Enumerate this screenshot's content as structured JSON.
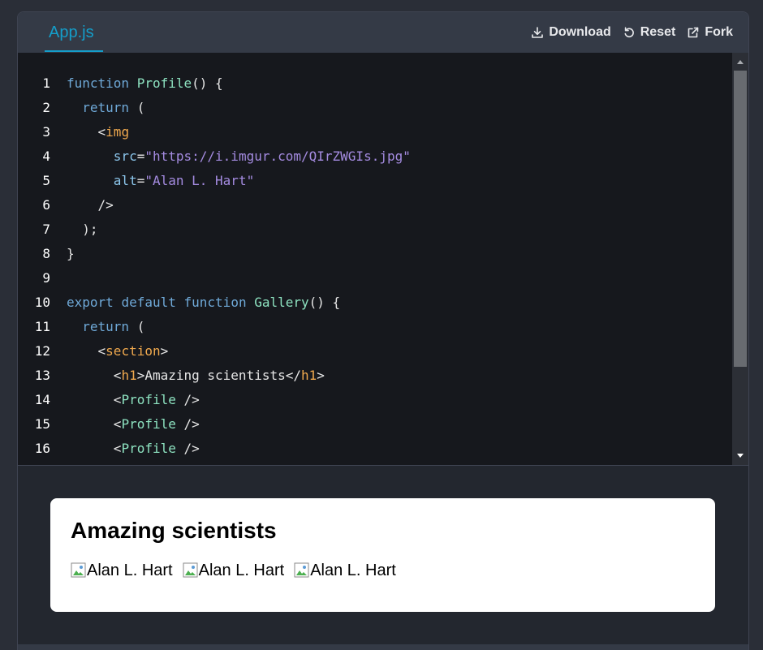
{
  "tab": {
    "label": "App.js"
  },
  "actions": [
    {
      "label": "Download",
      "icon": "download-icon"
    },
    {
      "label": "Reset",
      "icon": "reset-icon"
    },
    {
      "label": "Fork",
      "icon": "external-link-icon"
    }
  ],
  "colors": {
    "accent": "#149eca",
    "keyword": "#6fa9d8",
    "function_name": "#8de2c0",
    "tag": "#f0a94e",
    "attribute": "#8cc6ec",
    "string": "#a48be0"
  },
  "code": {
    "lines": [
      {
        "n": "1",
        "tokens": [
          [
            "kw",
            "function"
          ],
          [
            "p",
            " "
          ],
          [
            "fn",
            "Profile"
          ],
          [
            "p",
            "() {"
          ]
        ]
      },
      {
        "n": "2",
        "tokens": [
          [
            "p",
            "  "
          ],
          [
            "kw",
            "return"
          ],
          [
            "p",
            " ("
          ]
        ]
      },
      {
        "n": "3",
        "tokens": [
          [
            "p",
            "    <"
          ],
          [
            "tag",
            "img"
          ]
        ]
      },
      {
        "n": "4",
        "tokens": [
          [
            "p",
            "      "
          ],
          [
            "attr",
            "src"
          ],
          [
            "p",
            "="
          ],
          [
            "str",
            "\"https://i.imgur.com/QIrZWGIs.jpg\""
          ]
        ]
      },
      {
        "n": "5",
        "tokens": [
          [
            "p",
            "      "
          ],
          [
            "attr",
            "alt"
          ],
          [
            "p",
            "="
          ],
          [
            "str",
            "\"Alan L. Hart\""
          ]
        ]
      },
      {
        "n": "6",
        "tokens": [
          [
            "p",
            "    />"
          ]
        ]
      },
      {
        "n": "7",
        "tokens": [
          [
            "p",
            "  );"
          ]
        ]
      },
      {
        "n": "8",
        "tokens": [
          [
            "p",
            "}"
          ]
        ]
      },
      {
        "n": "9",
        "tokens": []
      },
      {
        "n": "10",
        "tokens": [
          [
            "kw",
            "export"
          ],
          [
            "p",
            " "
          ],
          [
            "kw",
            "default"
          ],
          [
            "p",
            " "
          ],
          [
            "kw",
            "function"
          ],
          [
            "p",
            " "
          ],
          [
            "fn",
            "Gallery"
          ],
          [
            "p",
            "() {"
          ]
        ]
      },
      {
        "n": "11",
        "tokens": [
          [
            "p",
            "  "
          ],
          [
            "kw",
            "return"
          ],
          [
            "p",
            " ("
          ]
        ]
      },
      {
        "n": "12",
        "tokens": [
          [
            "p",
            "    <"
          ],
          [
            "tag",
            "section"
          ],
          [
            "p",
            ">"
          ]
        ]
      },
      {
        "n": "13",
        "tokens": [
          [
            "p",
            "      <"
          ],
          [
            "tag",
            "h1"
          ],
          [
            "p",
            ">Amazing scientists</"
          ],
          [
            "tag",
            "h1"
          ],
          [
            "p",
            ">"
          ]
        ]
      },
      {
        "n": "14",
        "tokens": [
          [
            "p",
            "      <"
          ],
          [
            "comp",
            "Profile"
          ],
          [
            "p",
            " />"
          ]
        ]
      },
      {
        "n": "15",
        "tokens": [
          [
            "p",
            "      <"
          ],
          [
            "comp",
            "Profile"
          ],
          [
            "p",
            " />"
          ]
        ]
      },
      {
        "n": "16",
        "tokens": [
          [
            "p",
            "      <"
          ],
          [
            "comp",
            "Profile"
          ],
          [
            "p",
            " />"
          ]
        ]
      }
    ]
  },
  "preview": {
    "title": "Amazing scientists",
    "images": [
      {
        "alt": "Alan L. Hart",
        "icon": "broken-image-icon"
      },
      {
        "alt": "Alan L. Hart",
        "icon": "broken-image-icon"
      },
      {
        "alt": "Alan L. Hart",
        "icon": "broken-image-icon"
      }
    ]
  }
}
